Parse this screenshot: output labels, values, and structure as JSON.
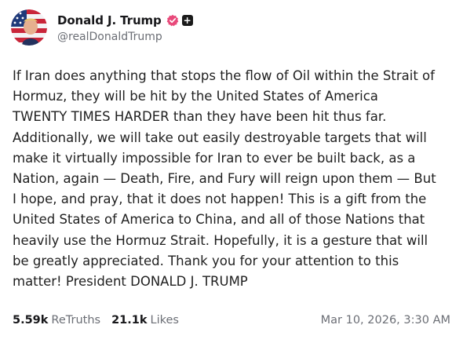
{
  "author": {
    "display_name": "Donald J. Trump",
    "handle": "@realDonaldTrump",
    "verified_icon": "verified-badge-icon",
    "verified_color": "#e8497a",
    "extra_badge": "+"
  },
  "post": {
    "text": "If Iran does anything that stops the flow of Oil within the Strait of\nHormuz, they will be hit by the United States of America\nTWENTY TIMES HARDER than they have been hit thus far.\nAdditionally, we will take out easily destroyable targets that will\nmake it virtually impossible for Iran to ever be built back, as a\nNation, again — Death, Fire, and Fury will reign upon them — But\nI hope, and pray, that it does not happen! This is a gift from the\nUnited States of America to China, and all of those Nations that\nheavily use the Hormuz Strait. Hopefully, it is a gesture that will\nbe greatly appreciated. Thank you for your attention to this\nmatter! President DONALD J. TRUMP"
  },
  "stats": {
    "retruths_count": "5.59k",
    "retruths_label": "ReTruths",
    "likes_count": "21.1k",
    "likes_label": "Likes"
  },
  "timestamp": "Mar 10, 2026, 3:30 AM"
}
